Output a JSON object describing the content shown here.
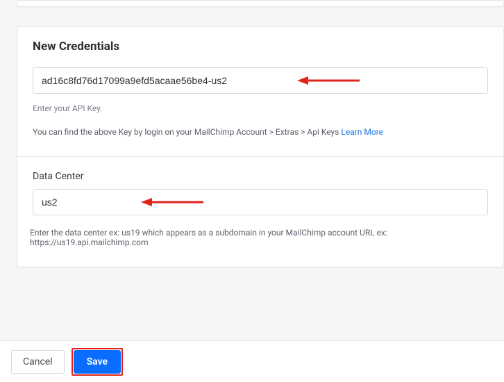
{
  "card": {
    "title": "New Credentials",
    "api_key": {
      "value": "ad16c8fd76d17099a9efd5acaae56be4-us2",
      "help": "Enter your API Key.",
      "instructions_prefix": "You can find the above Key by login on your MailChimp Account > Extras > Api Keys ",
      "learn_more": "Learn More"
    },
    "data_center": {
      "label": "Data Center",
      "value": "us2",
      "help": "Enter the data center ex: us19 which appears as a subdomain in your MailChimp account URL ex: https://us19.api.mailchimp.com"
    }
  },
  "footer": {
    "cancel": "Cancel",
    "save": "Save"
  }
}
